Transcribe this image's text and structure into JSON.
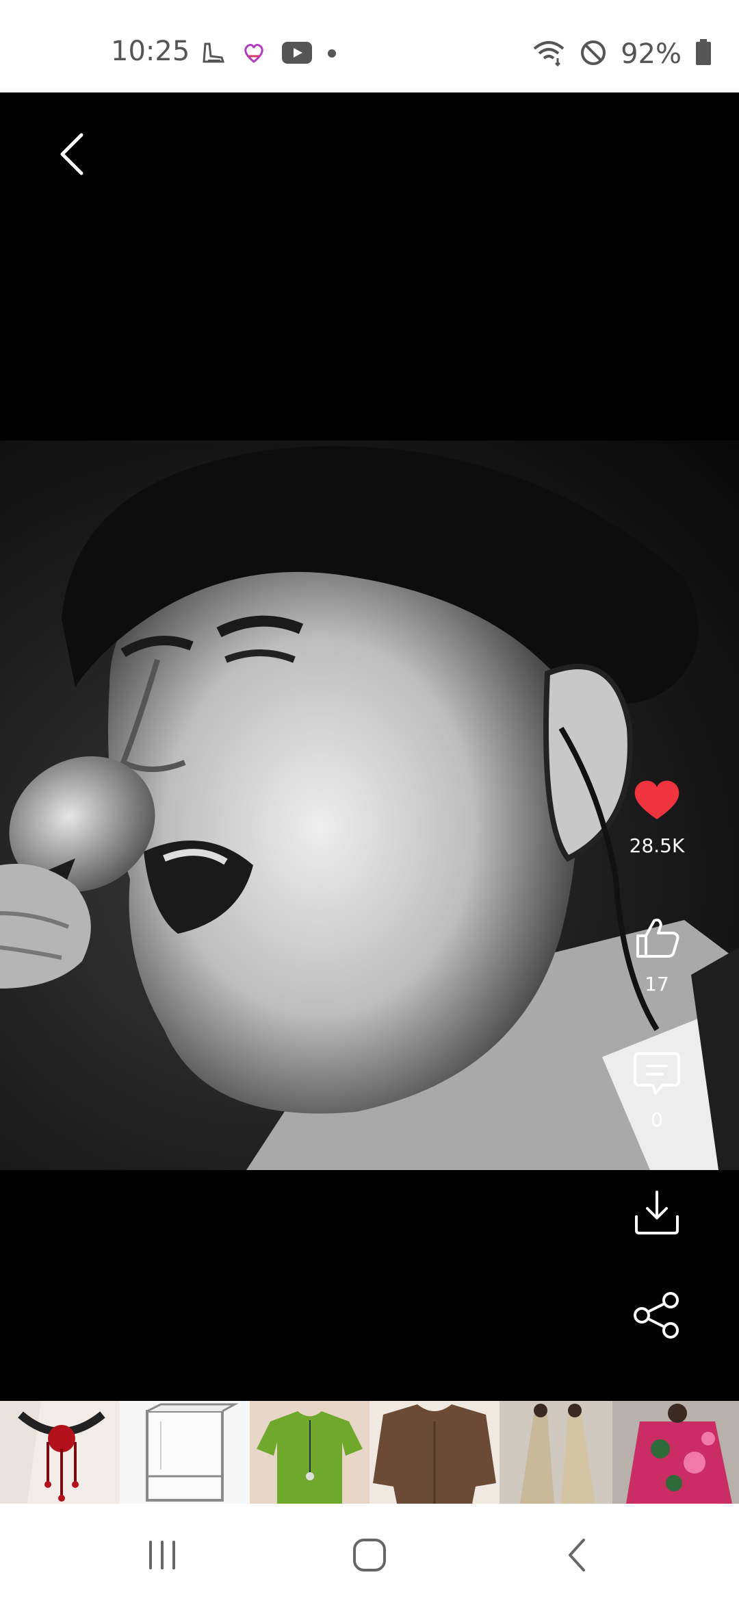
{
  "status_bar": {
    "time": "10:25",
    "battery": "92%",
    "left_icons": [
      "boot-icon",
      "heart-app-icon",
      "youtube-icon",
      "dot-icon"
    ],
    "right_icons": [
      "wifi-icon",
      "do-not-disturb-icon",
      "battery-icon"
    ]
  },
  "actions": {
    "favorite_count": "28.5K",
    "like_count": "17",
    "comment_count": "0",
    "favorite_color": "#f0343f"
  },
  "products": [
    {
      "name": "red-rose-choker"
    },
    {
      "name": "white-cabinet"
    },
    {
      "name": "green-blouse"
    },
    {
      "name": "brown-linen-top"
    },
    {
      "name": "beige-dress-set"
    },
    {
      "name": "pink-floral-dress"
    }
  ]
}
